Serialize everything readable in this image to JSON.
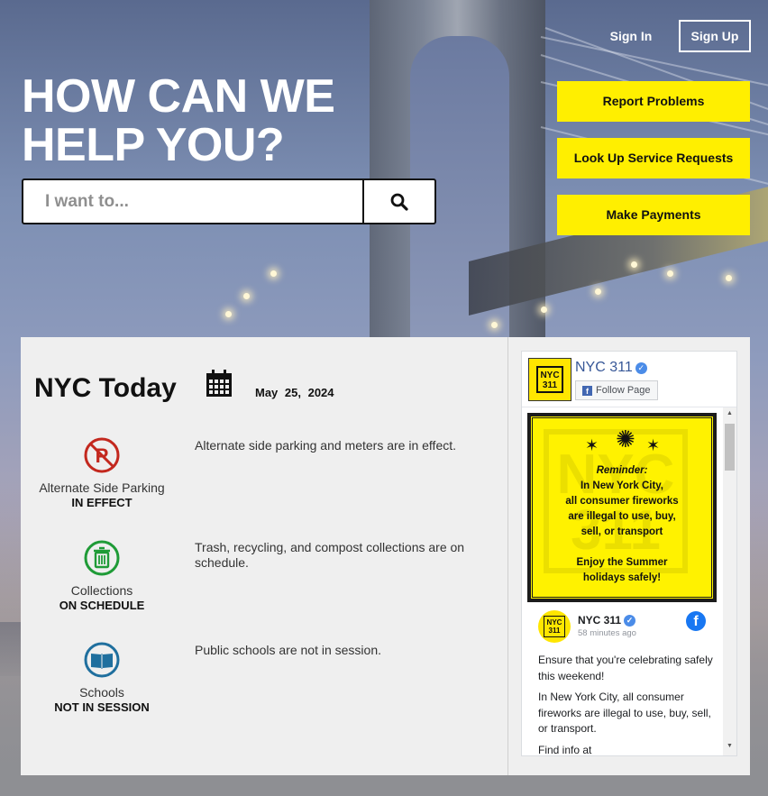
{
  "header": {
    "sign_in": "Sign In",
    "sign_up": "Sign Up"
  },
  "hero": {
    "headline_line1": "HOW CAN WE",
    "headline_line2": "HELP YOU?",
    "search_placeholder": "I want to...",
    "search_value": ""
  },
  "actions": [
    "Report Problems",
    "Look Up Service Requests",
    "Make Payments"
  ],
  "today": {
    "title": "NYC Today",
    "date": "May 25, 2024",
    "items": [
      {
        "label": "Alternate Side Parking",
        "status": "IN EFFECT",
        "icon": "no-parking-icon",
        "color": "#c3281e",
        "description": "Alternate side parking and meters are in effect."
      },
      {
        "label": "Collections",
        "status": "ON SCHEDULE",
        "icon": "trash-can-icon",
        "color": "#1f9b37",
        "description": "Trash, recycling, and compost collections are on schedule."
      },
      {
        "label": "Schools",
        "status": "NOT IN SESSION",
        "icon": "book-icon",
        "color": "#1f6f9e",
        "description": "Public schools are not in session."
      }
    ]
  },
  "facebook": {
    "page_name": "NYC 311",
    "follow_label": "Follow Page",
    "logo_text": "NYC 311",
    "poster": {
      "reminder": "Reminder:",
      "line1": "In New York City,",
      "line2": "all consumer fireworks",
      "line3": "are illegal to use, buy,",
      "line4": "sell, or transport",
      "enjoy1": "Enjoy the Summer",
      "enjoy2": "holidays safely!",
      "watermark": "NYC 311"
    },
    "post": {
      "author": "NYC 311",
      "time": "58 minutes ago",
      "para1": "Ensure that you're celebrating safely this weekend!",
      "para2": "In New York City, all consumer fireworks are illegal to use, buy, sell, or transport.",
      "para3": "Find info at"
    }
  },
  "colors": {
    "accent_yellow": "#ffef00",
    "facebook_blue": "#1877f2"
  }
}
